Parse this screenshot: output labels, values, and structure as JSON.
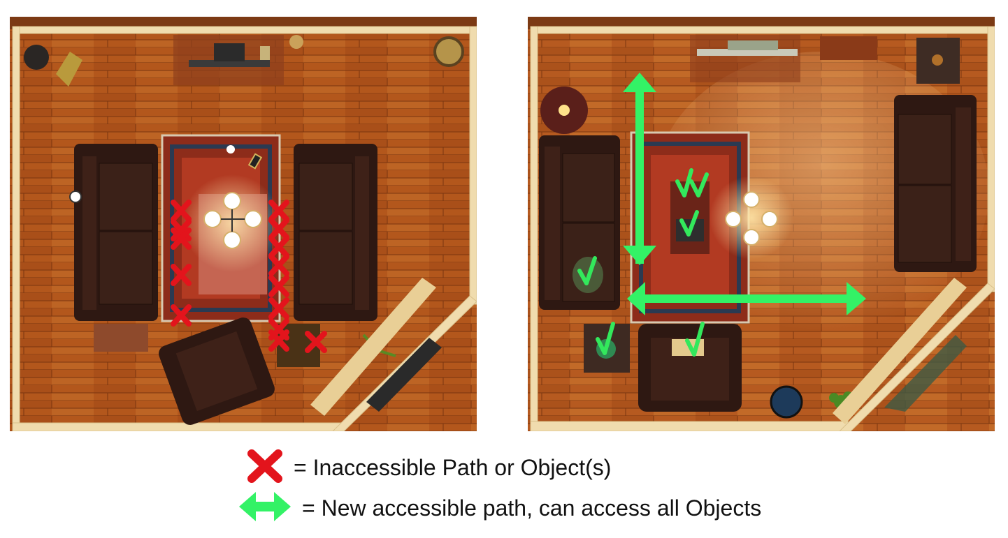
{
  "colors": {
    "floor": "#b45a1e",
    "floor_dark": "#8e4214",
    "wall": "#f2dfb4",
    "sofa": "#3a1f16",
    "rug": "#8c2a1a",
    "inaccessible_mark": "#e3141c",
    "accessible_arrow": "#33f266",
    "check": "#33e85c"
  },
  "legend": {
    "inaccessible": {
      "icon": "red-x-icon",
      "text": "= Inaccessible Path or Object(s)"
    },
    "accessible": {
      "icon": "green-double-arrow-icon",
      "text": "= New accessible path, can access all Objects"
    }
  }
}
